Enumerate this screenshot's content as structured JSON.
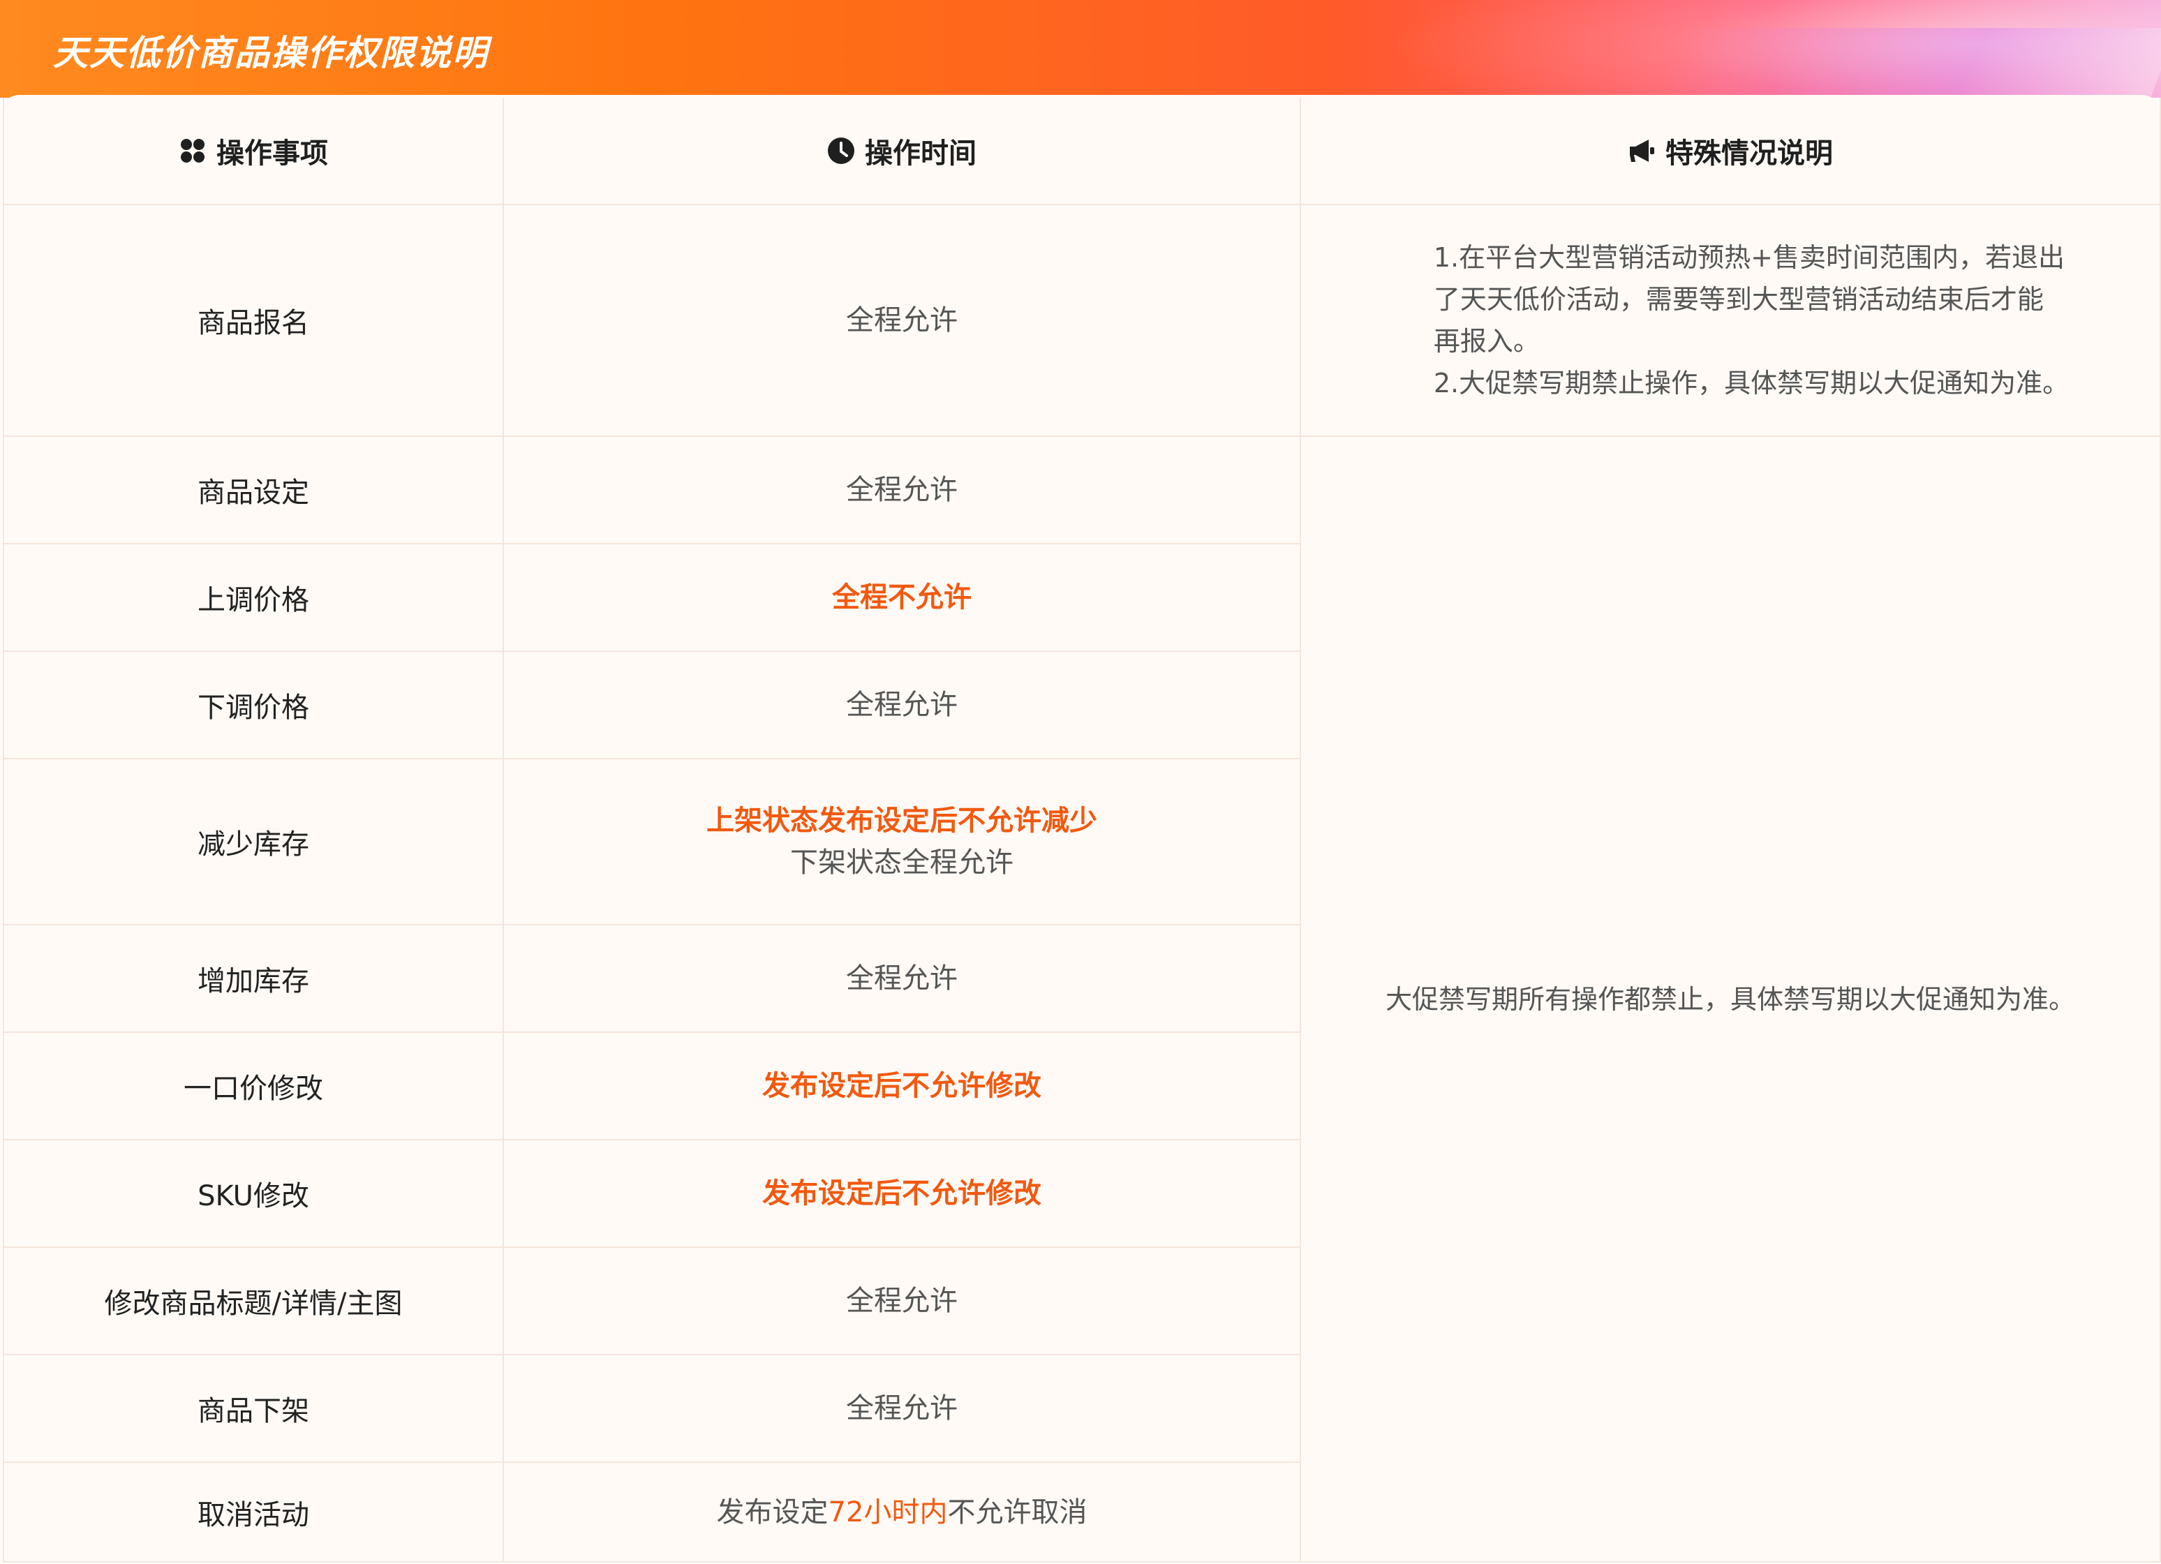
{
  "title": "天天低价商品操作权限说明",
  "colors": {
    "accent": "#f2590f",
    "border": "#f6e5dc",
    "panel_bg": "#fffaf6"
  },
  "headers": {
    "item": "操作事项",
    "time": "操作时间",
    "note": "特殊情况说明",
    "icons": [
      "grid-icon",
      "clock-icon",
      "megaphone-icon"
    ]
  },
  "rows": [
    {
      "item": "商品报名",
      "time": "全程允许"
    },
    {
      "item": "商品设定",
      "time": "全程允许"
    },
    {
      "item": "上调价格",
      "time": "全程不允许"
    },
    {
      "item": "下调价格",
      "time": "全程允许"
    },
    {
      "item": "减少库存",
      "time_line1": "上架状态发布设定后不允许减少",
      "time_line2": "下架状态全程允许"
    },
    {
      "item": "增加库存",
      "time": "全程允许"
    },
    {
      "item": "一口价修改",
      "time": "发布设定后不允许修改"
    },
    {
      "item": "SKU修改",
      "time": "发布设定后不允许修改"
    },
    {
      "item": "修改商品标题/详情/主图",
      "time": "全程允许"
    },
    {
      "item": "商品下架",
      "time": "全程允许"
    },
    {
      "item": "取消活动",
      "time_pre": "发布设定",
      "time_highlight": "72小时内",
      "time_post": "不允许取消"
    }
  ],
  "notes": {
    "first": [
      "1.在平台大型营销活动预热+售卖时间范围内，若退出",
      "了天天低价活动，需要等到大型营销活动结束后才能",
      "再报入。",
      "2.大促禁写期禁止操作，具体禁写期以大促通知为准。"
    ],
    "second": "大促禁写期所有操作都禁止，具体禁写期以大促通知为准。"
  }
}
